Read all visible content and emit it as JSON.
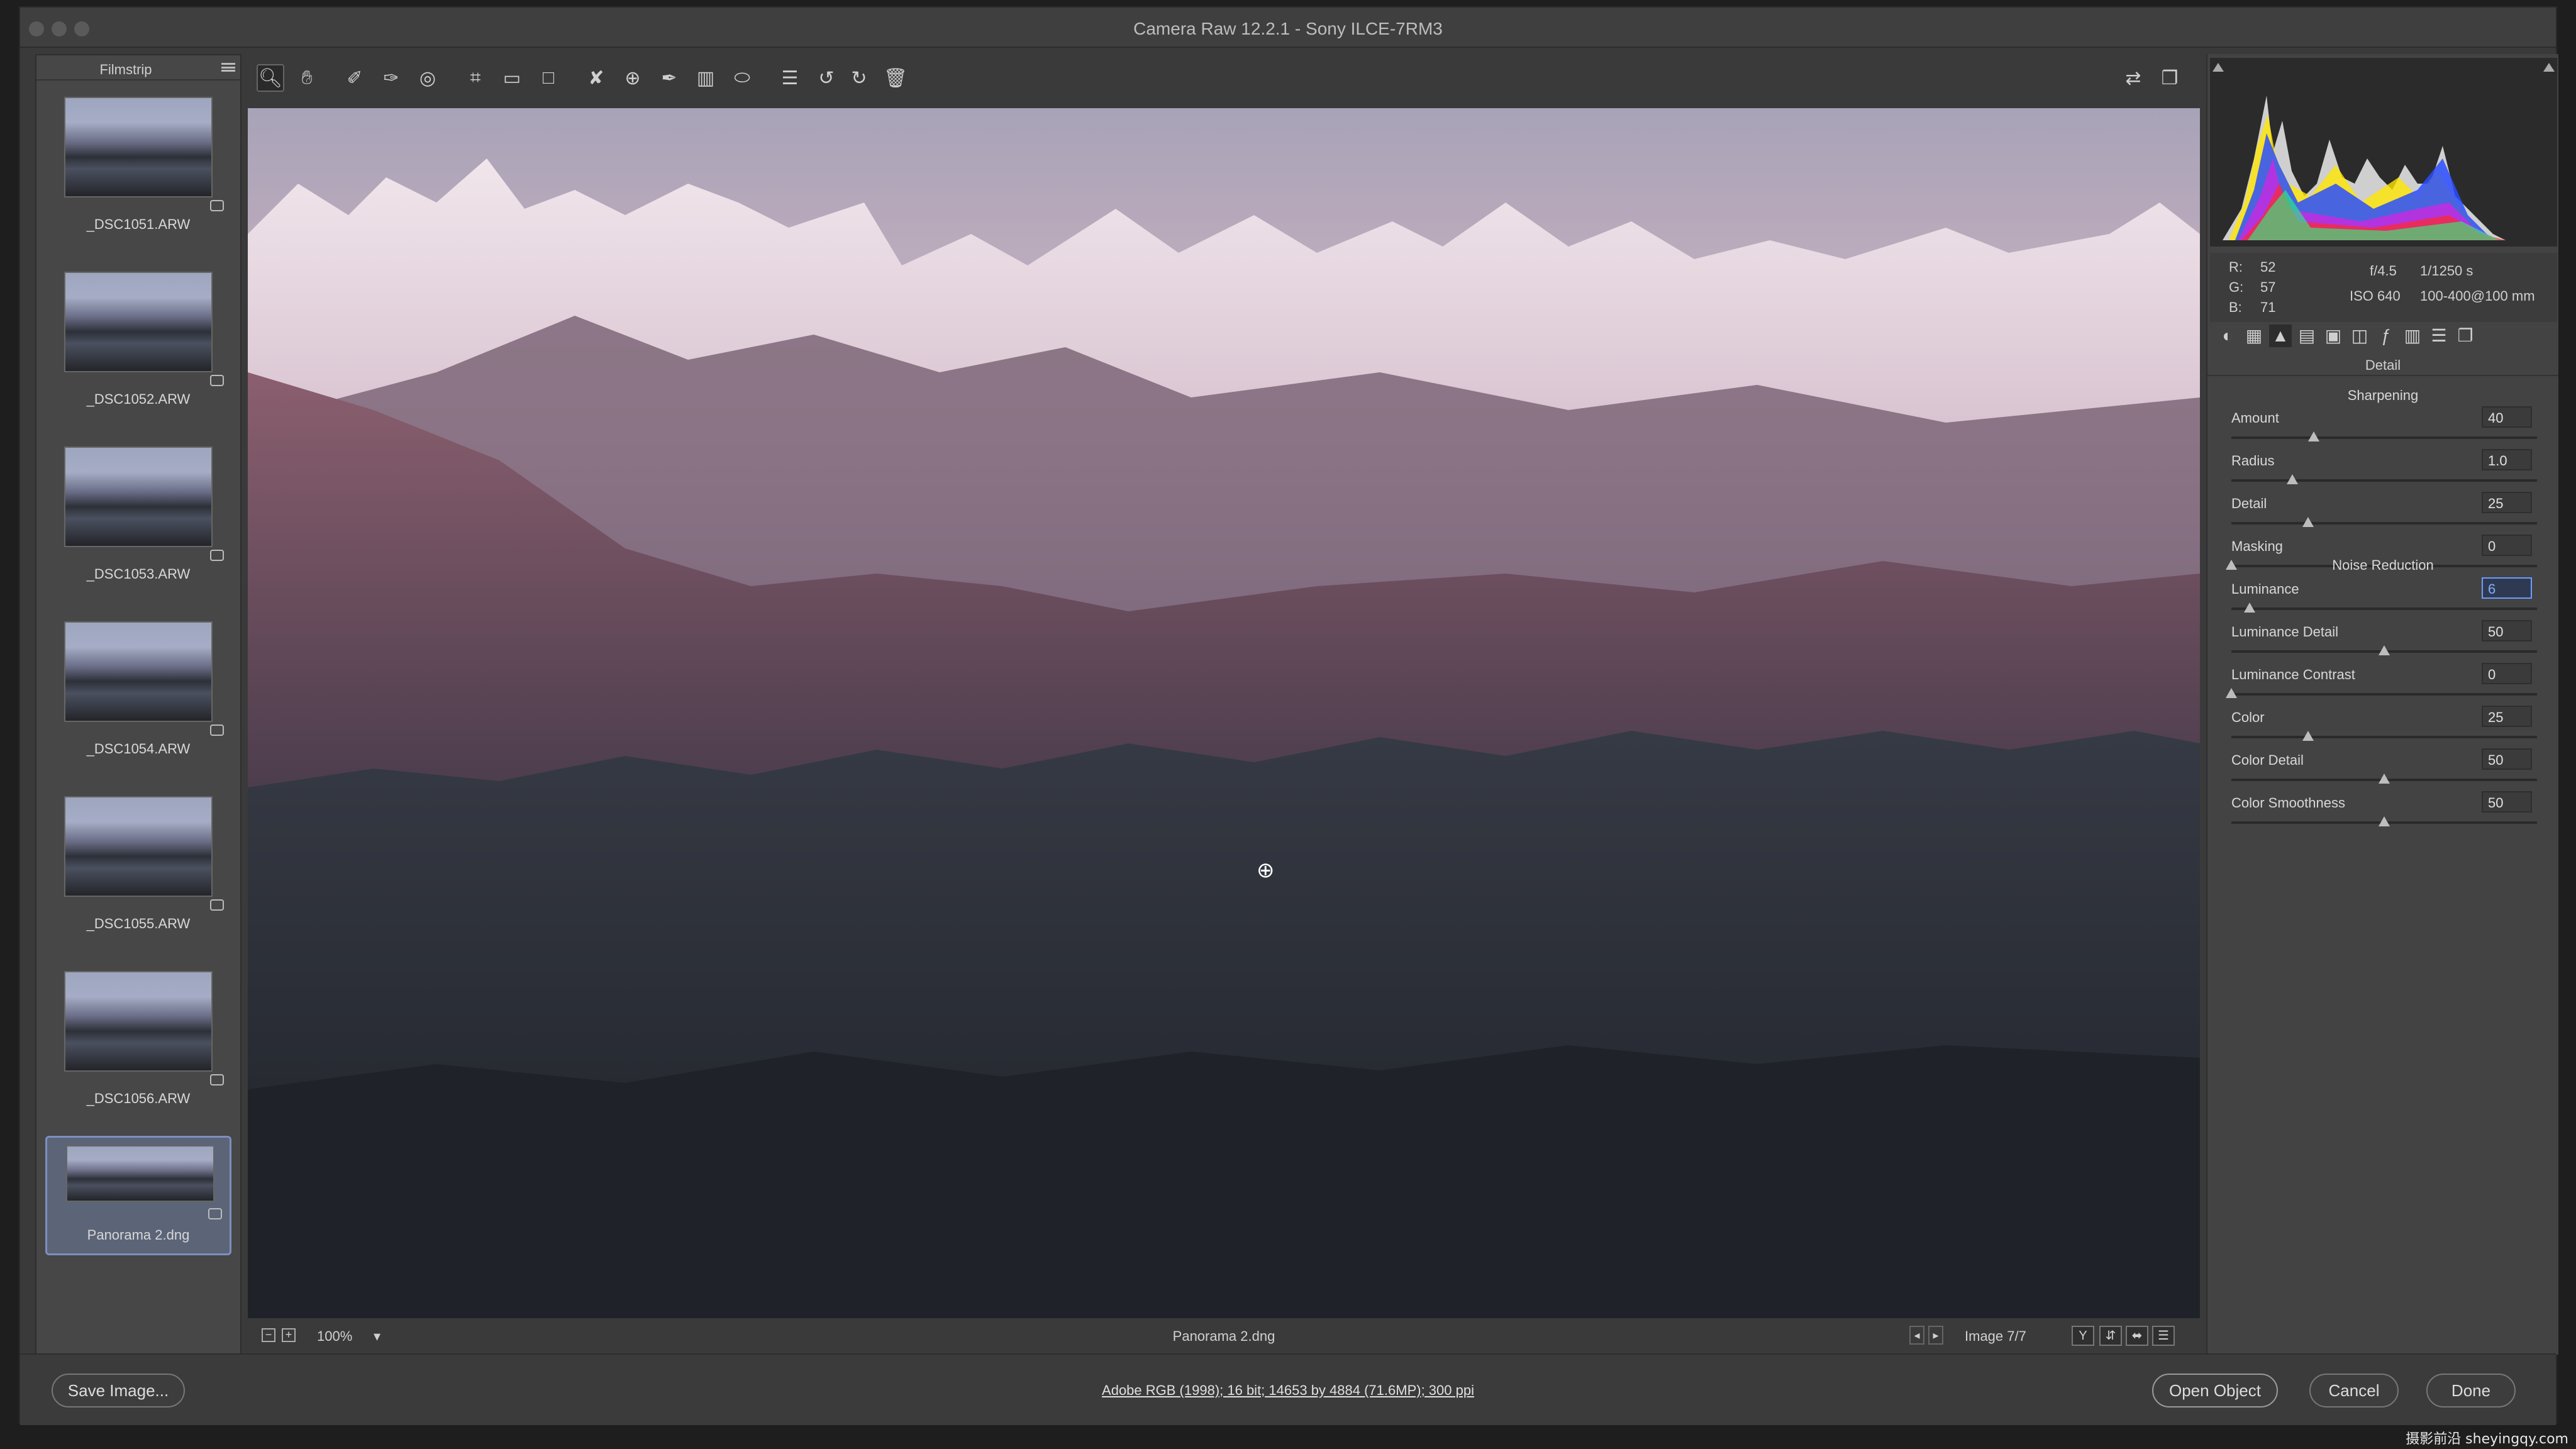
{
  "window": {
    "title": "Camera Raw 12.2.1  -  Sony ILCE-7RM3"
  },
  "filmstrip": {
    "label": "Filmstrip",
    "items": [
      {
        "name": "_DSC1051.ARW"
      },
      {
        "name": "_DSC1052.ARW"
      },
      {
        "name": "_DSC1053.ARW"
      },
      {
        "name": "_DSC1054.ARW"
      },
      {
        "name": "_DSC1055.ARW"
      },
      {
        "name": "_DSC1056.ARW"
      },
      {
        "name": "Panorama 2.dng",
        "selected": true
      }
    ]
  },
  "toolbar": {
    "tools": [
      "zoom-tool-icon",
      "hand-tool-icon",
      "white-balance-icon",
      "color-sampler-icon",
      "targeted-adjustment-icon",
      "crop-icon",
      "straighten-icon",
      "transform-icon",
      "spot-removal-icon",
      "red-eye-icon",
      "adjustment-brush-icon",
      "graduated-filter-icon",
      "radial-filter-icon",
      "presets-list-icon",
      "rotate-left-icon",
      "rotate-right-icon",
      "trash-icon"
    ]
  },
  "status": {
    "zoom": "100%",
    "filename": "Panorama 2.dng",
    "image_counter": "Image 7/7"
  },
  "readout": {
    "r_label": "R:",
    "r": "52",
    "g_label": "G:",
    "g": "57",
    "b_label": "B:",
    "b": "71",
    "aperture": "f/4.5",
    "shutter": "1/1250 s",
    "iso": "ISO 640",
    "lens": "100-400@100 mm"
  },
  "panel": {
    "title": "Detail",
    "sharpening": {
      "heading": "Sharpening",
      "sliders": [
        {
          "label": "Amount",
          "value": "40",
          "pos": 0.27
        },
        {
          "label": "Radius",
          "value": "1.0",
          "pos": 0.2
        },
        {
          "label": "Detail",
          "value": "25",
          "pos": 0.25
        },
        {
          "label": "Masking",
          "value": "0",
          "pos": 0.0
        }
      ]
    },
    "noise": {
      "heading": "Noise Reduction",
      "sliders": [
        {
          "label": "Luminance",
          "value": "6",
          "pos": 0.06,
          "focused": true
        },
        {
          "label": "Luminance Detail",
          "value": "50",
          "pos": 0.5
        },
        {
          "label": "Luminance Contrast",
          "value": "0",
          "pos": 0.0
        },
        {
          "label": "Color",
          "value": "25",
          "pos": 0.25
        },
        {
          "label": "Color Detail",
          "value": "50",
          "pos": 0.5
        },
        {
          "label": "Color Smoothness",
          "value": "50",
          "pos": 0.5
        }
      ]
    }
  },
  "bottom": {
    "save_label": "Save Image...",
    "workflow_info": "Adobe RGB (1998); 16 bit; 14653 by 4884 (71.6MP); 300 ppi",
    "open_label": "Open Object",
    "cancel_label": "Cancel",
    "done_label": "Done"
  },
  "watermark": "摄影前沿 sheyingqy.com"
}
